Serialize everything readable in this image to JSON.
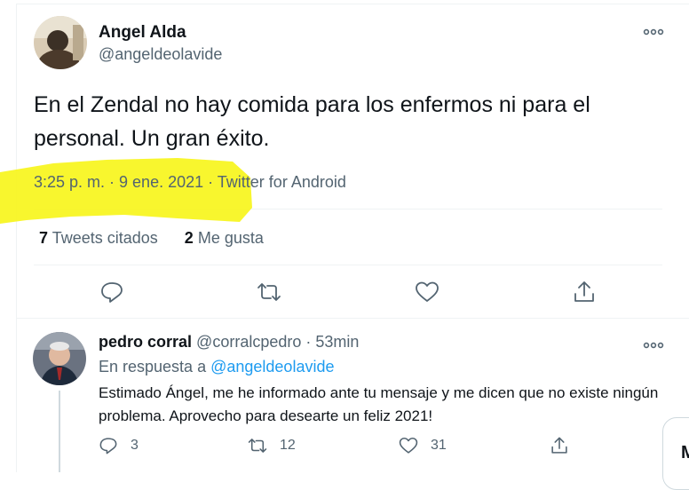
{
  "main_tweet": {
    "author_name": "Angel Alda",
    "author_handle": "@angeldeolavide",
    "text": "En el Zendal no hay comida para los enfermos ni para el personal. Un gran éxito.",
    "time": "3:25 p. m. · 9 ene. 2021 · Twitter for Android",
    "stats": {
      "quotes_count": "7",
      "quotes_label": "Tweets citados",
      "likes_count": "2",
      "likes_label": "Me gusta"
    }
  },
  "reply": {
    "author_name": "pedro corral",
    "author_handle": "@corralcpedro",
    "time": "· 53min",
    "in_reply_prefix": "En respuesta a",
    "in_reply_handle": "@angeldeolavide",
    "text": "Estimado Ángel, me he informado ante tu mensaje y me dicen que no existe ningún problema. Aprovecho para desearte un feliz 2021!",
    "reply_count": "3",
    "retweet_count": "12",
    "like_count": "31"
  },
  "corner_card_letter": "M",
  "colors": {
    "secondary_text": "#536471",
    "link": "#1d9bf0",
    "divider": "#eff3f4",
    "highlighter": "#f7f51c"
  },
  "icons": [
    "more-icon",
    "reply-icon",
    "retweet-icon",
    "like-icon",
    "share-icon"
  ]
}
